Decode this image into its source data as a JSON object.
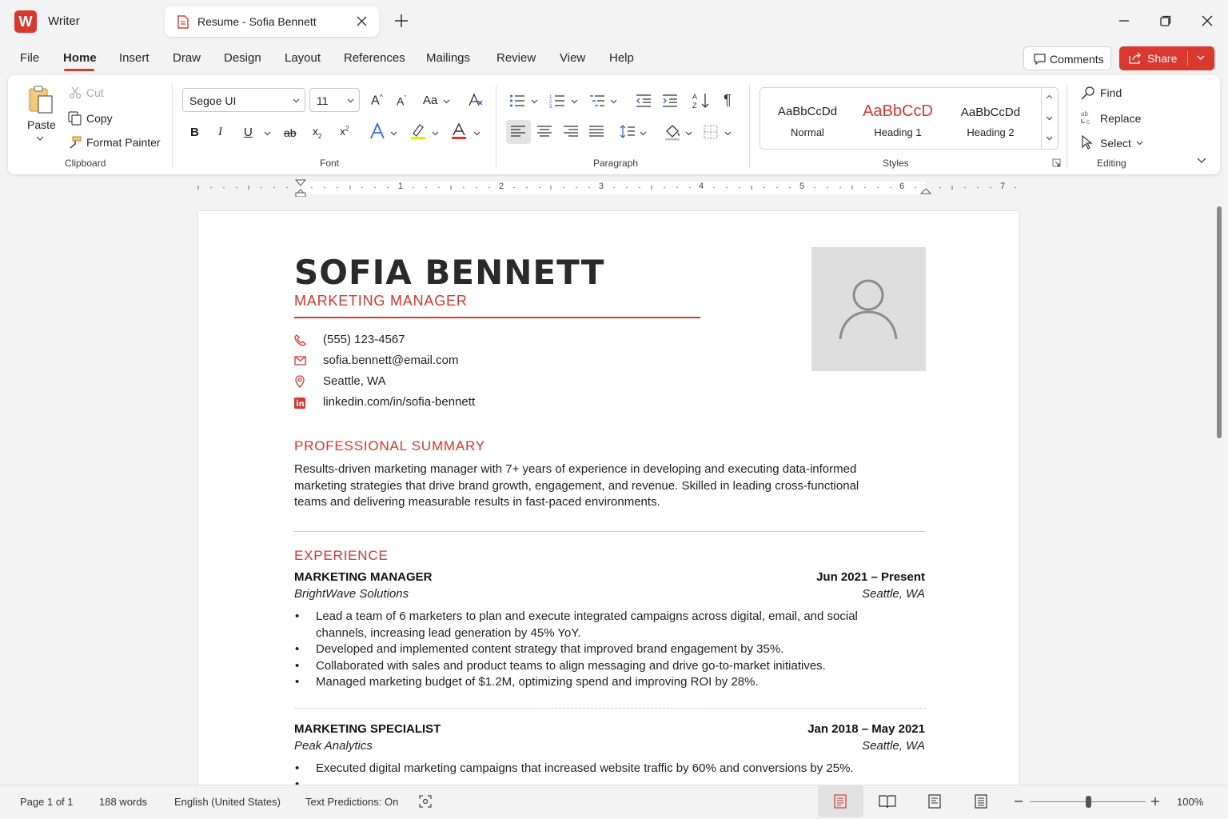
{
  "app": {
    "name": "Writer",
    "logo_letter": "W"
  },
  "tab": {
    "title": "Resume - Sofia Bennett"
  },
  "menu": {
    "items": [
      "File",
      "Home",
      "Insert",
      "Draw",
      "Design",
      "Layout",
      "References",
      "Mailings",
      "Review",
      "View",
      "Help"
    ],
    "active": "Home",
    "comments_label": "Comments",
    "share_label": "Share"
  },
  "ribbon": {
    "clipboard": {
      "paste": "Paste",
      "cut": "Cut",
      "copy": "Copy",
      "format_painter": "Format Painter",
      "group": "Clipboard"
    },
    "font": {
      "family": "Segoe UI",
      "size": "11",
      "change_case": "Aa",
      "group": "Font"
    },
    "paragraph": {
      "group": "Paragraph"
    },
    "styles": {
      "items": [
        {
          "preview": "AaBbCcDd",
          "name": "Normal"
        },
        {
          "preview": "AaBbCcD",
          "name": "Heading 1"
        },
        {
          "preview": "AaBbCcDd",
          "name": "Heading 2"
        }
      ],
      "group": "Styles"
    },
    "editing": {
      "find": "Find",
      "replace": "Replace",
      "select": "Select",
      "group": "Editing"
    }
  },
  "ruler": {
    "numbers": [
      "1",
      "2",
      "3",
      "4",
      "5",
      "6",
      "7"
    ]
  },
  "document": {
    "name": "SOFIA BENNETT",
    "role": "MARKETING MANAGER",
    "contact": {
      "phone": "(555) 123-4567",
      "email": "sofia.bennett@email.com",
      "location": "Seattle, WA",
      "linkedin": "linkedin.com/in/sofia-bennett"
    },
    "summary": {
      "title": "PROFESSIONAL SUMMARY",
      "lines": [
        "Results-driven marketing manager with 7+ years of experience in developing and executing data-informed",
        "marketing strategies that drive brand growth, engagement, and revenue. Skilled in leading cross-functional",
        "teams and delivering measurable results in fast-paced environments."
      ]
    },
    "experience": {
      "title": "EXPERIENCE",
      "jobs": [
        {
          "title": "MARKETING MANAGER",
          "dates": "Jun 2021 – Present",
          "company": "BrightWave Solutions",
          "location": "Seattle, WA",
          "bullets": [
            "Lead a team of 6 marketers to plan and execute integrated campaigns across digital, email, and social",
            "channels, increasing lead generation by 45% YoY.",
            "Developed and implemented content strategy that improved brand engagement by 35%.",
            "Collaborated with sales and product teams to align messaging and drive go-to-market initiatives.",
            "Managed marketing budget of $1.2M, optimizing spend and improving ROI by 28%."
          ]
        },
        {
          "title": "MARKETING SPECIALIST",
          "dates": "Jan 2018 – May 2021",
          "company": "Peak Analytics",
          "location": "Seattle, WA",
          "bullets": [
            "Executed digital marketing campaigns that increased website traffic by 60% and conversions by 25%."
          ]
        }
      ]
    }
  },
  "status": {
    "page": "Page 1 of 1",
    "words": "188 words",
    "language": "English (United States)",
    "predictions": "Text Predictions: On",
    "zoom": "100%",
    "zoom_level": 0.5
  },
  "colors": {
    "accent": "#d9382f",
    "text": "#222222",
    "page": "#ffffff",
    "canvas": "#f3f3f3"
  }
}
